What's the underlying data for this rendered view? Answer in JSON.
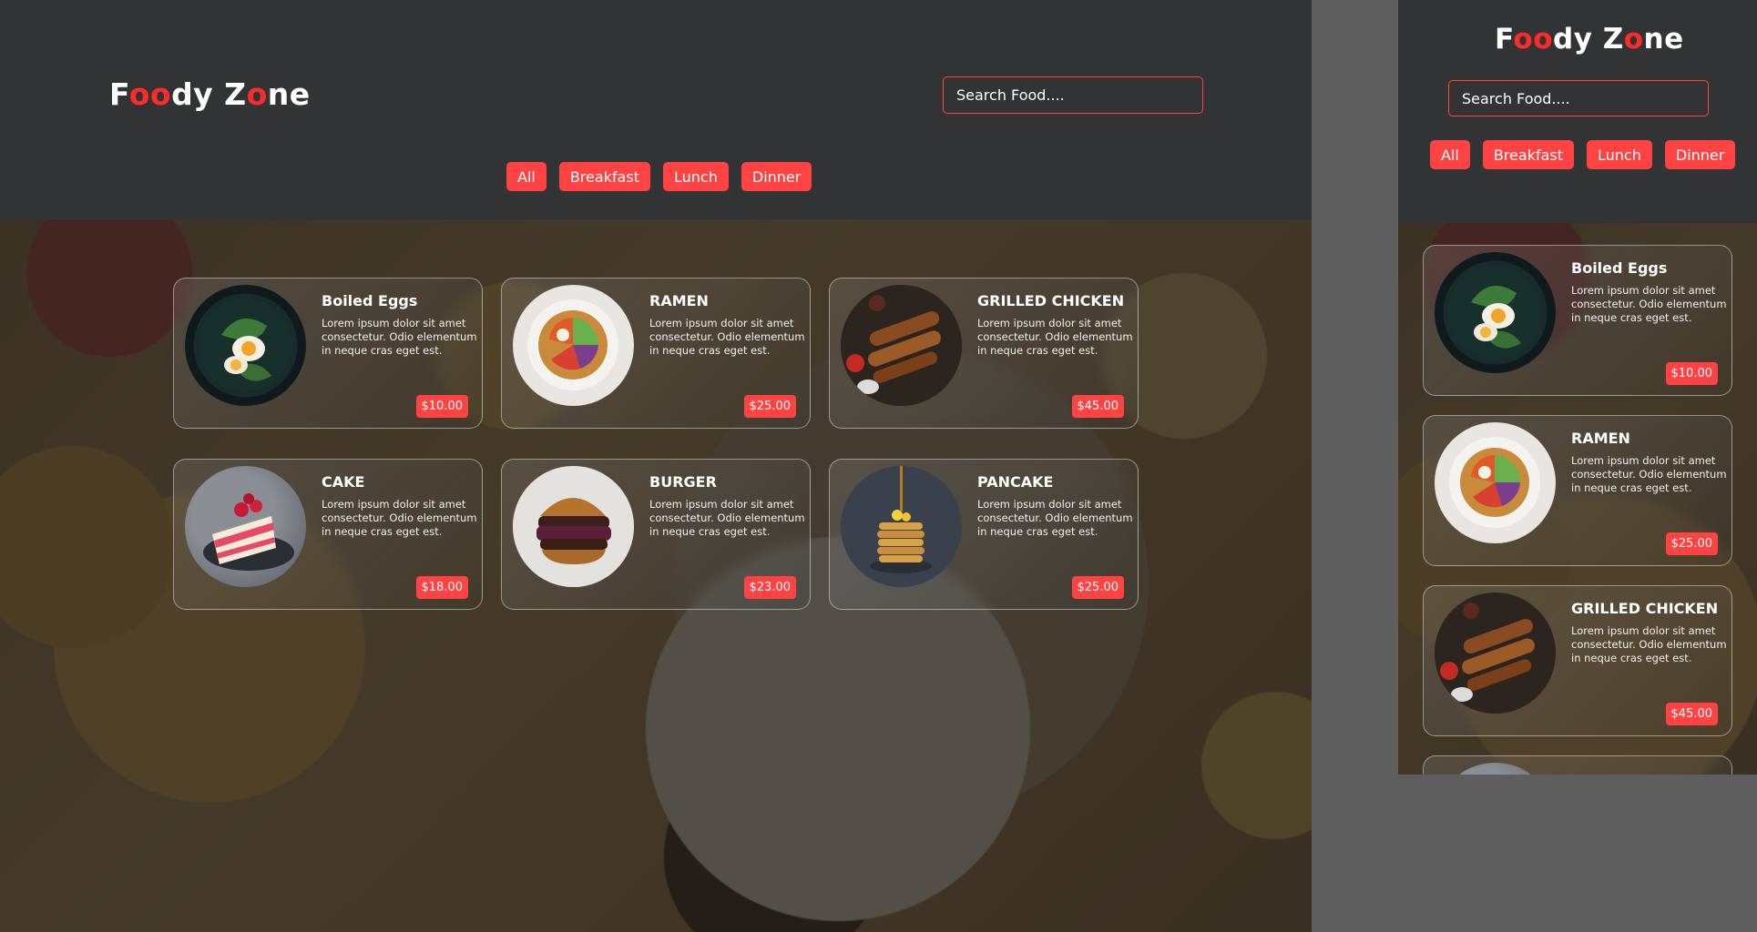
{
  "brand": {
    "prefix": "F",
    "o1": "o",
    "o2": "o",
    "mid": "dy Z",
    "o3": "o",
    "suffix": "ne",
    "accent": "#ff2a2a"
  },
  "search": {
    "placeholder": "Search Food...."
  },
  "filters": [
    "All",
    "Breakfast",
    "Lunch",
    "Dinner"
  ],
  "foods": [
    {
      "name": "Boiled Eggs",
      "text": "Lorem ipsum dolor sit amet consectetur. Odio elementum in neque cras eget est.",
      "price": "$10.00",
      "icon": "boiled-eggs-image"
    },
    {
      "name": "RAMEN",
      "text": "Lorem ipsum dolor sit amet consectetur. Odio elementum in neque cras eget est.",
      "price": "$25.00",
      "icon": "ramen-image"
    },
    {
      "name": "GRILLED CHICKEN",
      "text": "Lorem ipsum dolor sit amet consectetur. Odio elementum in neque cras eget est.",
      "price": "$45.00",
      "icon": "grilled-chicken-image"
    },
    {
      "name": "CAKE",
      "text": "Lorem ipsum dolor sit amet consectetur. Odio elementum in neque cras eget est.",
      "price": "$18.00",
      "icon": "cake-image"
    },
    {
      "name": "BURGER",
      "text": "Lorem ipsum dolor sit amet consectetur. Odio elementum in neque cras eget est.",
      "price": "$23.00",
      "icon": "burger-image"
    },
    {
      "name": "PANCAKE",
      "text": "Lorem ipsum dolor sit amet consectetur. Odio elementum in neque cras eget est.",
      "price": "$25.00",
      "icon": "pancake-image"
    }
  ],
  "colors": {
    "accent": "#ff4343",
    "header": "#323334",
    "backdrop": "#5e5e5e"
  }
}
